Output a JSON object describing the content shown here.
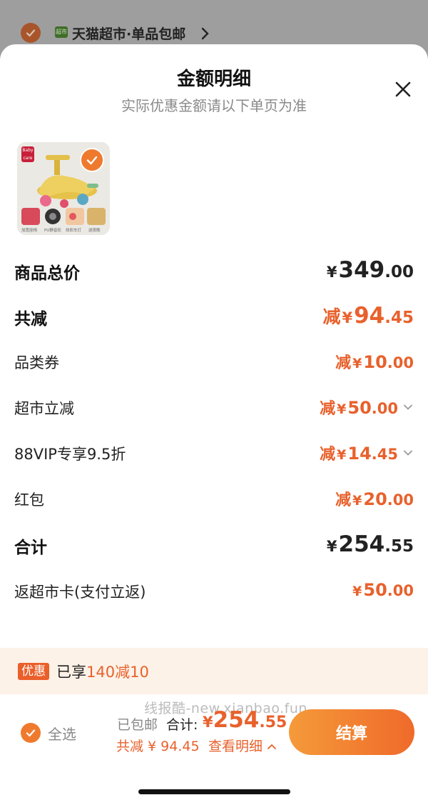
{
  "background": {
    "store_name": "天猫超市·单品包邮",
    "store_logo_text": "超市"
  },
  "sheet": {
    "title": "金额明细",
    "subtitle": "实际优惠金额请以下单页为准"
  },
  "product": {
    "brand_text": "Baby care",
    "features": [
      "加宽座椅",
      "PU静音轮",
      "炫彩车灯",
      "送夜晚"
    ]
  },
  "rows": [
    {
      "label": "商品总价",
      "prefix": "",
      "yen": "¥",
      "int": "349",
      "dec": ".00"
    },
    {
      "label": "共减",
      "prefix": "减",
      "yen": "¥",
      "int": "94",
      "dec": ".45"
    },
    {
      "label": "品类券",
      "prefix": "减",
      "yen": "¥",
      "int": "10",
      "dec": ".00"
    },
    {
      "label": "超市立减",
      "prefix": "减",
      "yen": "¥",
      "int": "50",
      "dec": ".00"
    },
    {
      "label": "88VIP专享9.5折",
      "prefix": "减",
      "yen": "¥",
      "int": "14",
      "dec": ".45"
    },
    {
      "label": "红包",
      "prefix": "减",
      "yen": "¥",
      "int": "20",
      "dec": ".00"
    },
    {
      "label": "合计",
      "prefix": "",
      "yen": "¥",
      "int": "254",
      "dec": ".55"
    },
    {
      "label": "返超市卡(支付立返)",
      "prefix": "",
      "yen": "¥",
      "int": "50",
      "dec": ".00"
    }
  ],
  "promo": {
    "tag": "优惠",
    "text_prefix": "已享",
    "highlight": "140减10"
  },
  "footer": {
    "watermark": "线报酷-new.xianbao.fun",
    "select_all": "全选",
    "shipping": "已包邮",
    "total_label": "合计:",
    "total_yen": "¥",
    "total_int": "254",
    "total_dec": ".55",
    "savings": "共减 ¥ 94.45",
    "detail_link": "查看明细",
    "checkout": "结算"
  },
  "colors": {
    "accent": "#e8612c",
    "checkout_start": "#f59a3a",
    "checkout_end": "#ef6a2a",
    "promo_bg": "#fdf2e8"
  }
}
